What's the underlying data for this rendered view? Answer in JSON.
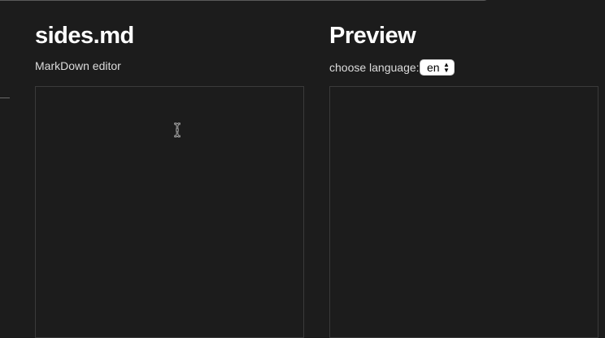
{
  "editor": {
    "title": "sides.md",
    "subtitle": "MarkDown editor",
    "content": ""
  },
  "preview": {
    "title": "Preview",
    "language_label": "choose language:",
    "language_selected": "en"
  },
  "icons": {
    "cursor": "text-cursor-icon",
    "select_arrows": "up-down-chevron-icon"
  }
}
